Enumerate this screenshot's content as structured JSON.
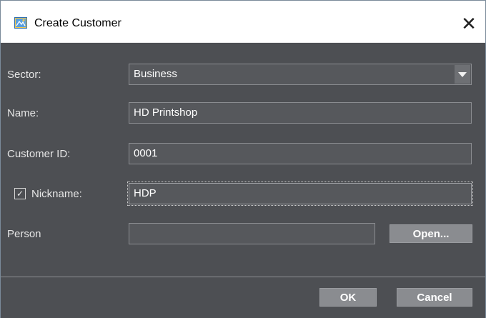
{
  "window": {
    "title": "Create Customer",
    "close_glyph": "✕"
  },
  "form": {
    "sector": {
      "label": "Sector:",
      "value": "Business"
    },
    "name": {
      "label": "Name:",
      "value": "HD Printshop"
    },
    "customer_id": {
      "label": "Customer ID:",
      "value": "0001"
    },
    "nickname": {
      "label": "Nickname:",
      "value": "HDP",
      "checked": true,
      "check_glyph": "✓"
    },
    "person": {
      "label": "Person",
      "value": "",
      "open_label": "Open..."
    }
  },
  "buttons": {
    "ok": "OK",
    "cancel": "Cancel"
  },
  "colors": {
    "panel": "#4d4f53",
    "field_bg": "#56585c",
    "button_bg": "#8a8c90"
  }
}
